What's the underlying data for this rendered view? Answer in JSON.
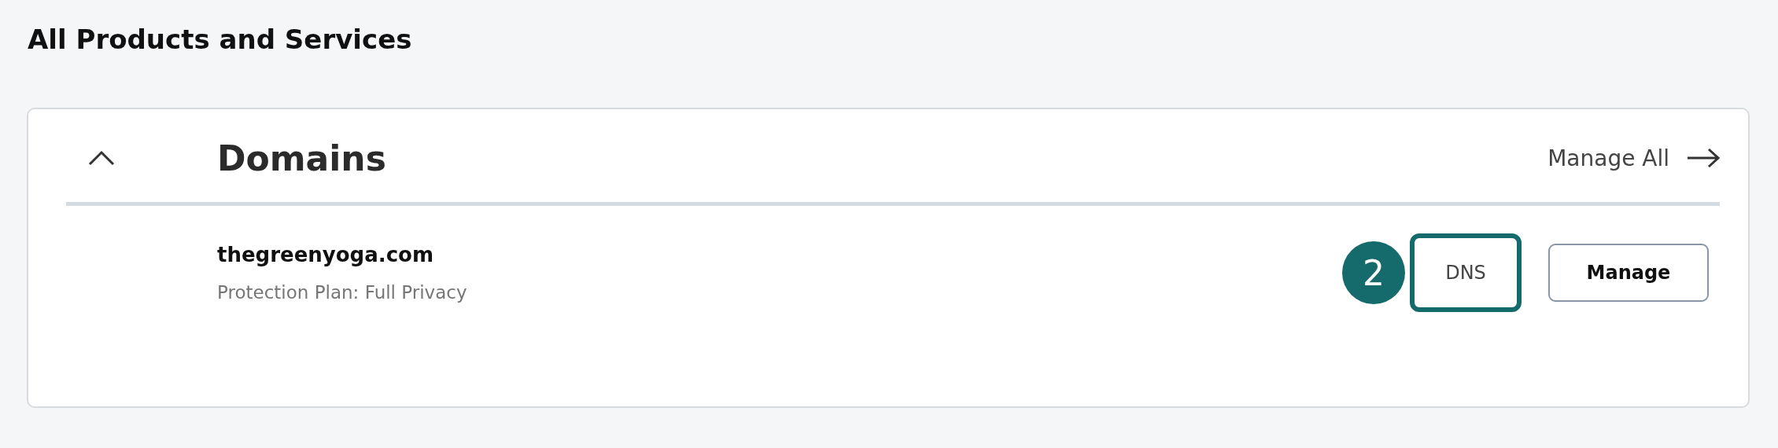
{
  "page_title": "All Products and Services",
  "section": {
    "title": "Domains",
    "expanded": true,
    "manage_all": "Manage All",
    "items": [
      {
        "name": "thegreenyoga.com",
        "detail": "Protection Plan: Full Privacy",
        "step_badge": "2",
        "buttons": [
          {
            "label": "DNS",
            "highlighted": true
          },
          {
            "label": "Manage",
            "highlighted": false
          }
        ]
      }
    ]
  }
}
